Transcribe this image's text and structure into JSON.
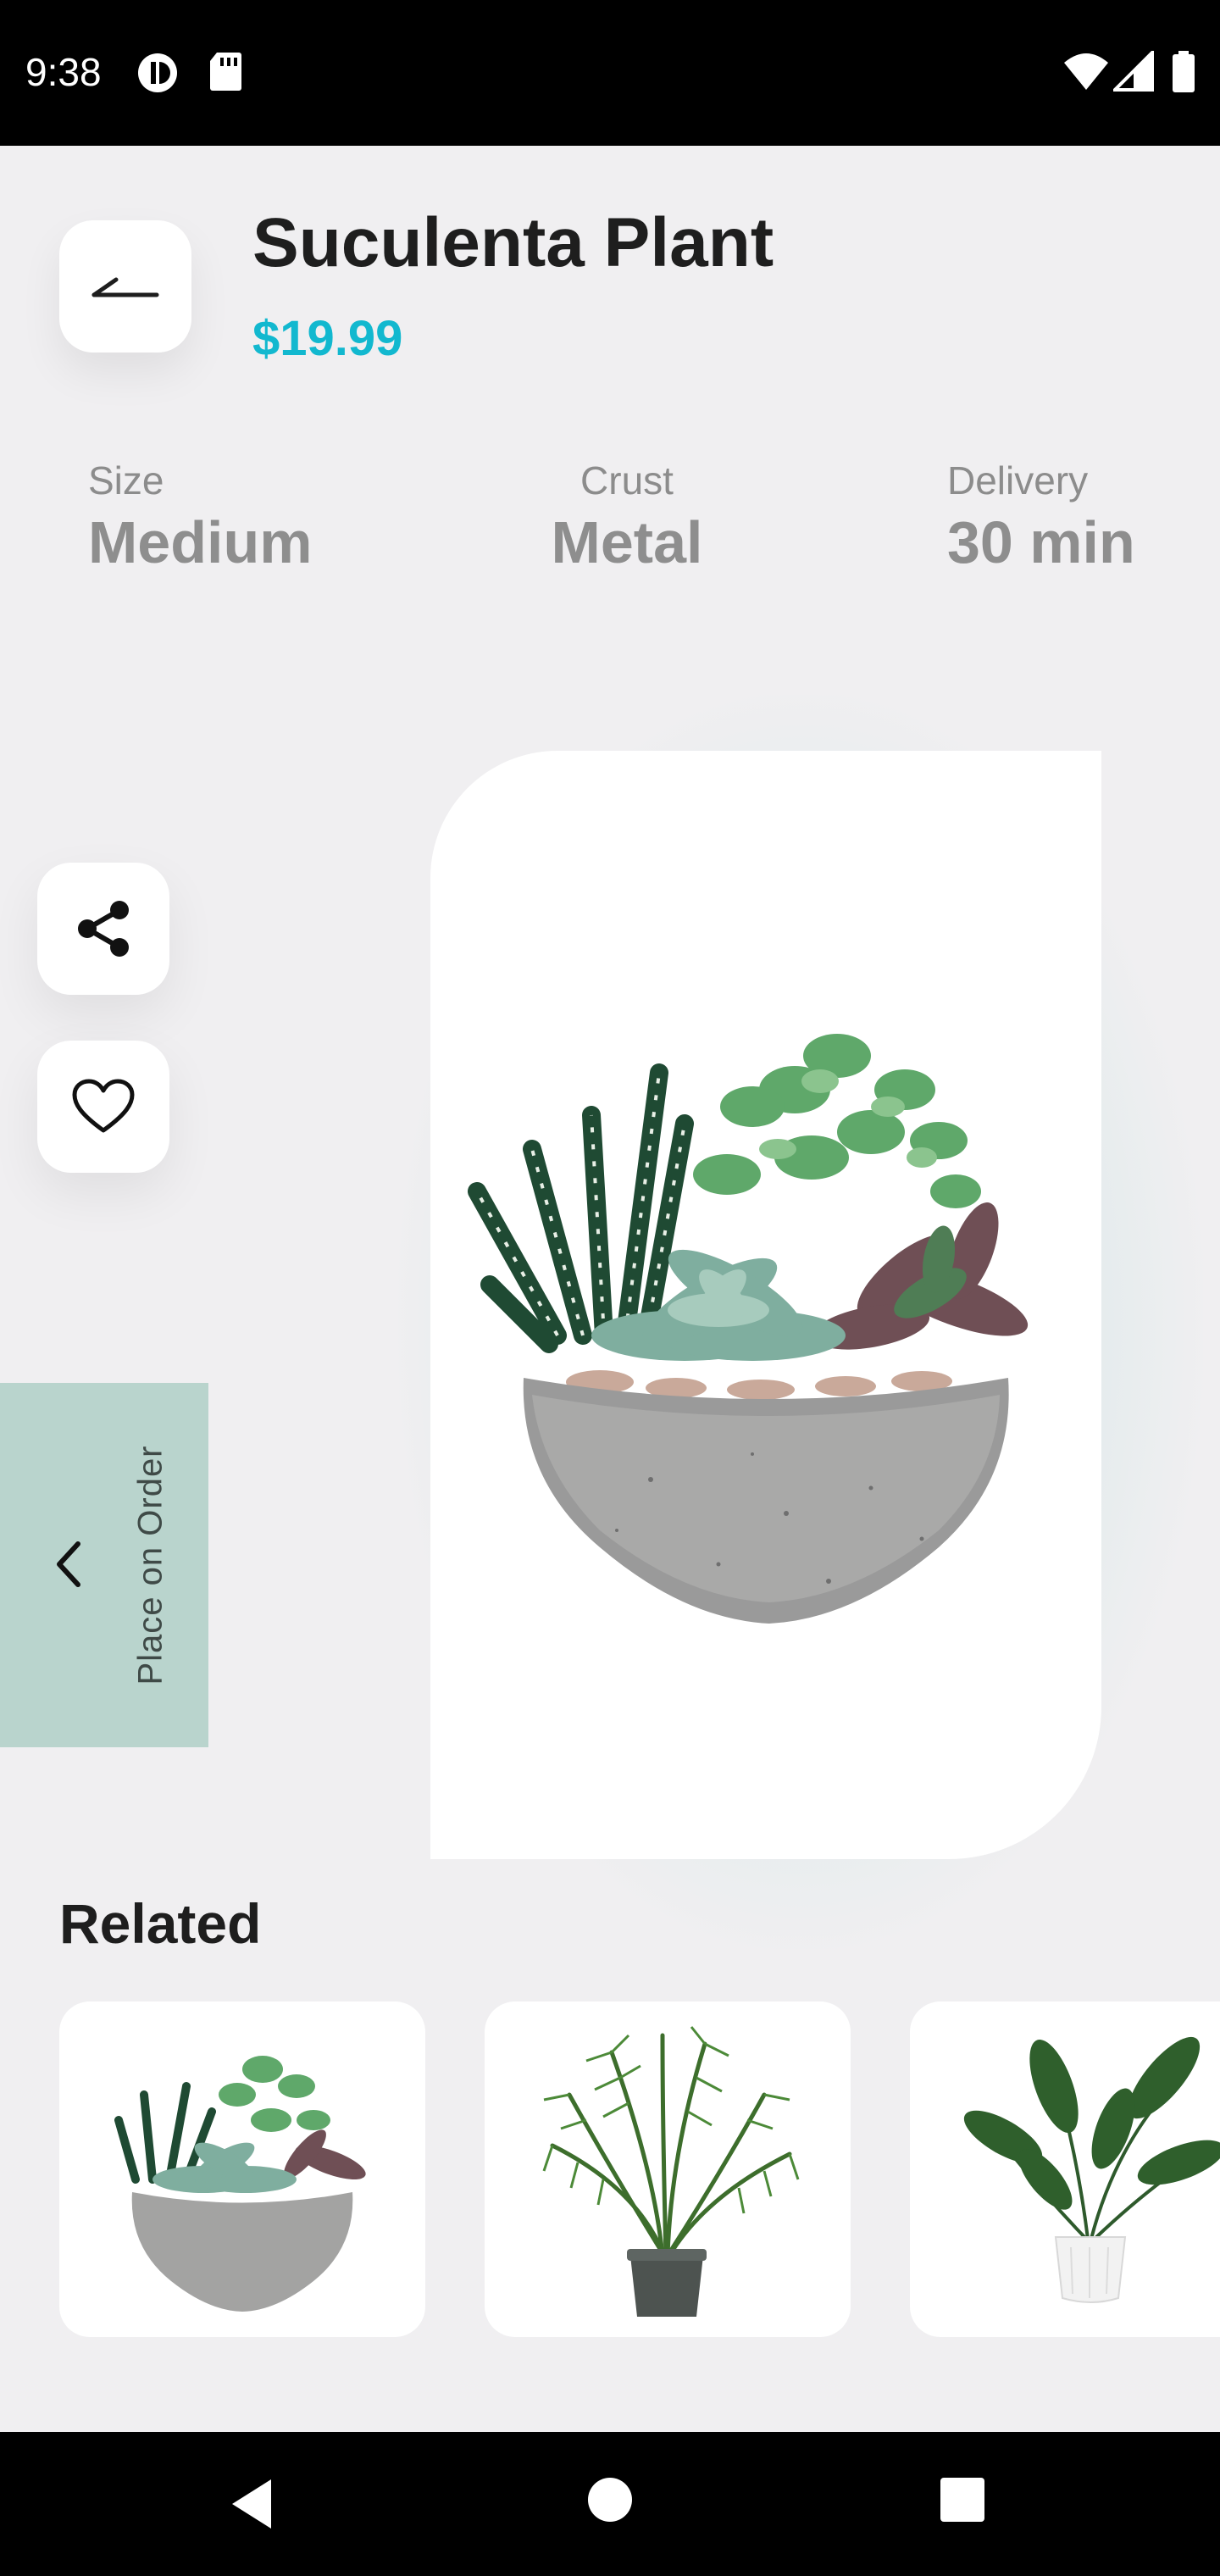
{
  "status_bar": {
    "time": "9:38"
  },
  "header": {
    "title": "Suculenta Plant",
    "price": "$19.99"
  },
  "specs": [
    {
      "label": "Size",
      "value": "Medium"
    },
    {
      "label": "Crust",
      "value": "Metal"
    },
    {
      "label": "Delivery",
      "value": "30 min"
    }
  ],
  "order_tab": {
    "label": "Place on Order"
  },
  "related": {
    "title": "Related"
  },
  "colors": {
    "accent_price": "#12b8cf",
    "order_tab": "#b9d4cd",
    "background": "#f0eff1"
  },
  "icons": {
    "back": "arrow-left-icon",
    "share": "share-icon",
    "favorite": "heart-icon",
    "order_chevron": "chevron-left-icon"
  }
}
